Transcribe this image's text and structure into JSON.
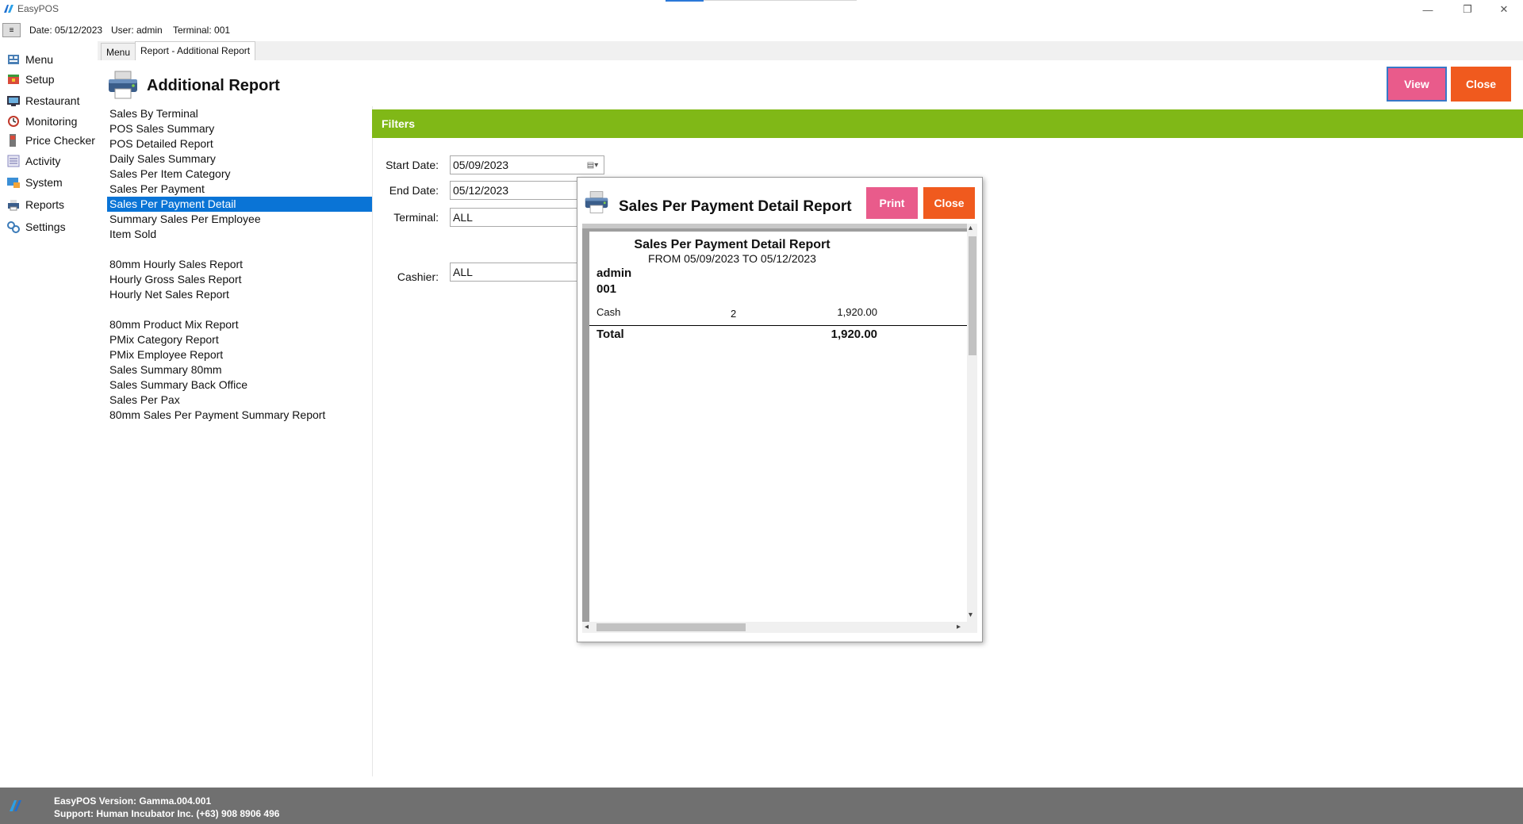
{
  "titlebar": {
    "title": "EasyPOS",
    "minimize": "—",
    "restore": "❐",
    "close": "✕"
  },
  "infobar": {
    "toggle": "≡",
    "date": "Date: 05/12/2023",
    "user": "User: admin",
    "terminal": "Terminal: 001"
  },
  "sidebar": {
    "items": [
      {
        "label": "Menu",
        "icon": "menu-icon"
      },
      {
        "label": "Setup",
        "icon": "setup-icon"
      },
      {
        "label": "Restaurant",
        "icon": "restaurant-icon"
      },
      {
        "label": "Monitoring",
        "icon": "monitoring-icon"
      },
      {
        "label": "Price Checker",
        "icon": "price-checker-icon"
      },
      {
        "label": "Activity",
        "icon": "activity-icon"
      },
      {
        "label": "System",
        "icon": "system-icon"
      },
      {
        "label": "Reports",
        "icon": "reports-icon"
      },
      {
        "label": "Settings",
        "icon": "settings-icon"
      }
    ]
  },
  "tabs": [
    {
      "label": "Menu"
    },
    {
      "label": "Report - Additional Report"
    }
  ],
  "header": {
    "title": "Additional Report",
    "view_label": "View",
    "close_label": "Close"
  },
  "report_list": [
    "Sales By Terminal",
    "POS Sales Summary",
    "POS Detailed Report",
    "Daily Sales Summary",
    "Sales Per Item Category",
    "Sales Per Payment",
    "Sales Per Payment Detail",
    "Summary Sales Per Employee",
    "Item Sold",
    "80mm Hourly Sales Report",
    "Hourly Gross Sales Report",
    "Hourly Net Sales Report",
    "80mm Product Mix Report",
    "PMix Category Report",
    "PMix Employee Report",
    "Sales Summary 80mm",
    "Sales Summary Back Office",
    "Sales Per Pax",
    "80mm Sales Per Payment Summary Report"
  ],
  "selected_report": "Sales Per Payment Detail",
  "filters": {
    "title": "Filters",
    "start_date_label": "Start Date:",
    "start_date": "05/09/2023",
    "end_date_label": "End Date:",
    "end_date": "05/12/2023",
    "terminal_label": "Terminal:",
    "terminal": "ALL",
    "cashier_label": "Cashier:",
    "cashier": "ALL"
  },
  "dialog": {
    "title": "Sales Per Payment Detail Report",
    "print_label": "Print",
    "close_label": "Close",
    "report": {
      "title": "Sales Per Payment Detail Report",
      "subtitle": "FROM 05/09/2023 TO 05/12/2023",
      "user": "admin",
      "terminal": "001",
      "rows": [
        {
          "payment": "Cash",
          "count": "2",
          "amount": "1,920.00"
        }
      ],
      "total_label": "Total",
      "total_amount": "1,920.00"
    }
  },
  "statusbar": {
    "logo_text": "Human Incubator",
    "version": "EasyPOS Version: Gamma.004.001",
    "support": "Support: Human Incubator Inc. (+63) 908 8906 496"
  },
  "colors": {
    "view_button": "#e95b8b",
    "close_button": "#f05a1e",
    "filters_bar": "#80b817",
    "selection": "#0a74d6",
    "statusbar": "#707070"
  }
}
